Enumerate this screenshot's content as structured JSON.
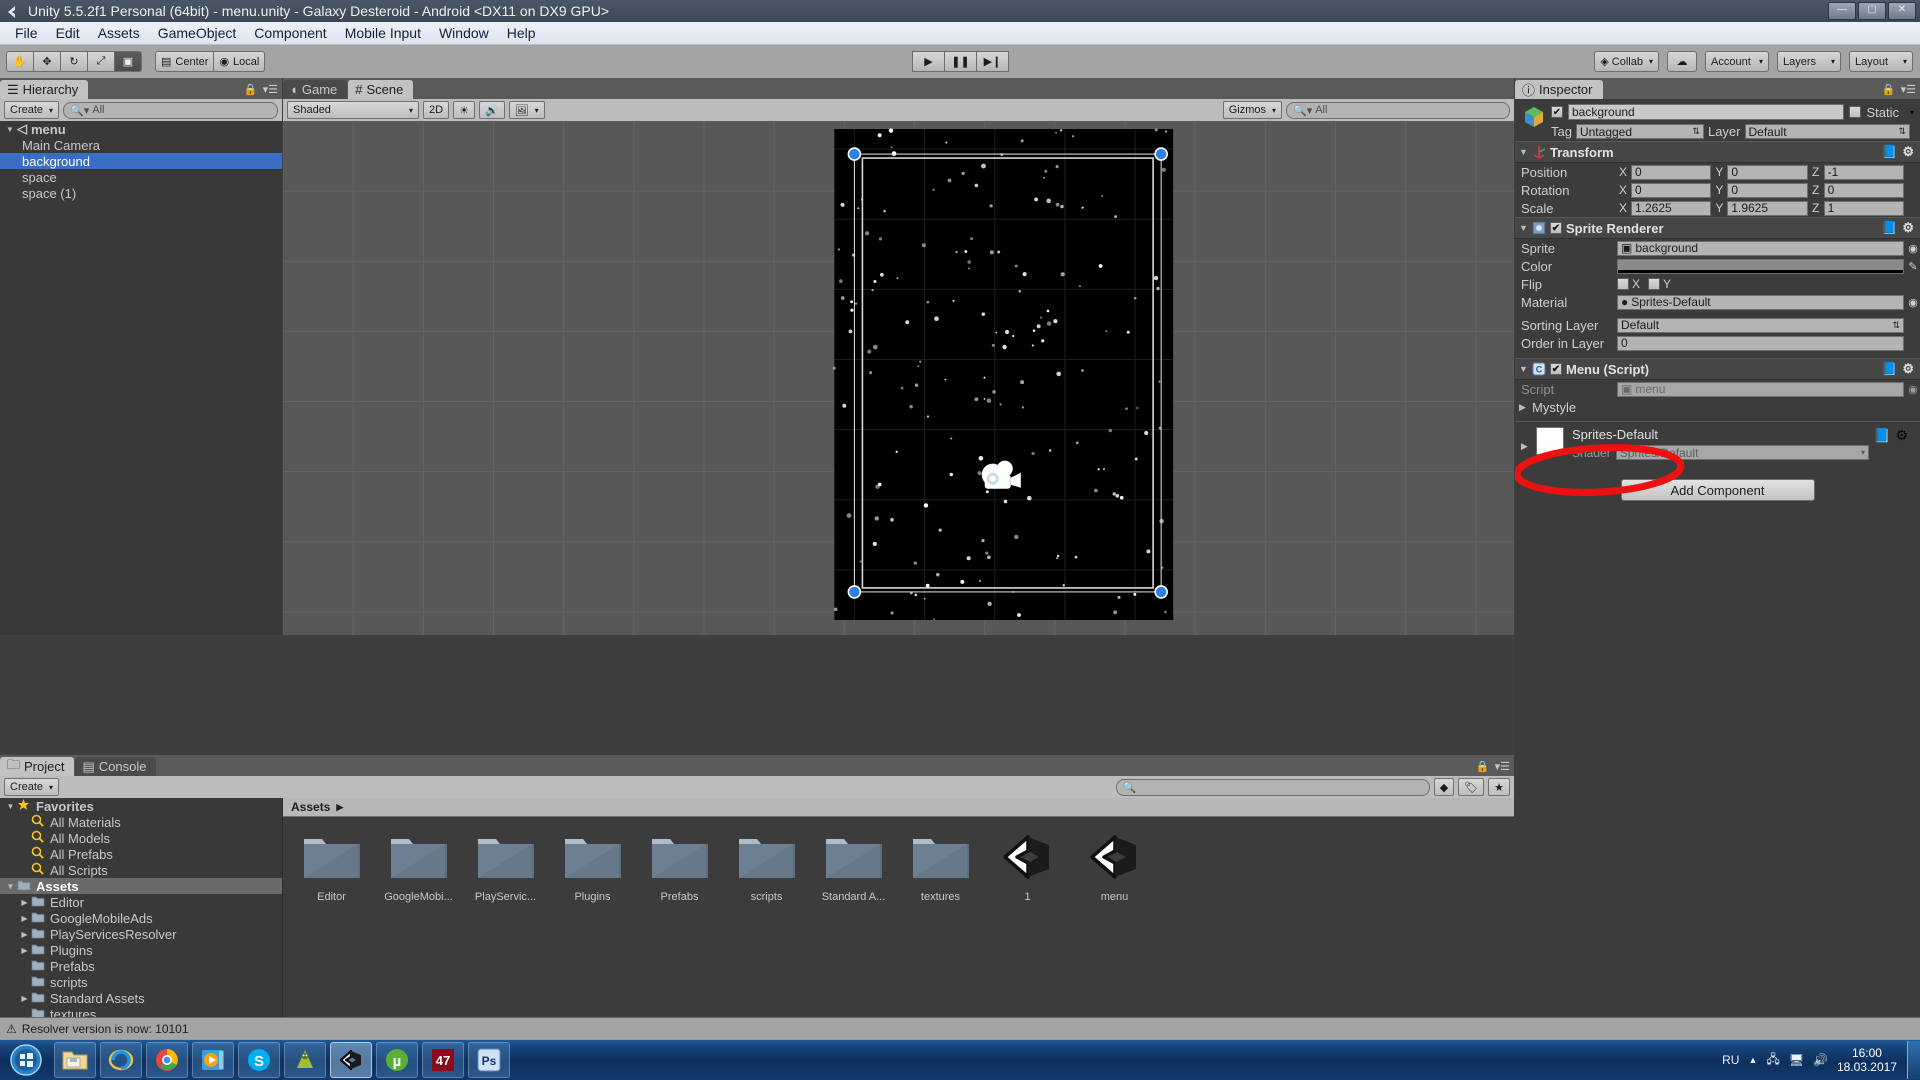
{
  "window": {
    "title": "Unity 5.5.2f1 Personal (64bit) - menu.unity - Galaxy Desteroid - Android <DX11 on DX9 GPU>",
    "minimize": "—",
    "maximize": "▢",
    "close": "✕"
  },
  "menubar": {
    "items": [
      "File",
      "Edit",
      "Assets",
      "GameObject",
      "Component",
      "Mobile Input",
      "Window",
      "Help"
    ]
  },
  "toolbar": {
    "tools": [
      {
        "name": "hand-tool",
        "glyph": "✋",
        "active": false
      },
      {
        "name": "move-tool",
        "glyph": "✥",
        "active": false
      },
      {
        "name": "rotate-tool",
        "glyph": "↻",
        "active": false
      },
      {
        "name": "scale-tool",
        "glyph": "⤢",
        "active": false
      },
      {
        "name": "rect-tool",
        "glyph": "▣",
        "active": true
      }
    ],
    "pivot_mode": "Center",
    "pivot_rotation": "Local",
    "play": "▶",
    "pause": "❚❚",
    "step": "▶❙",
    "collab": "Collab",
    "cloud": "☁",
    "account": "Account",
    "layers": "Layers",
    "layout": "Layout"
  },
  "hierarchy": {
    "tab": "Hierarchy",
    "create": "Create",
    "search_placeholder": "All",
    "items": [
      {
        "label": "menu",
        "depth": 0,
        "selected": false,
        "root": true
      },
      {
        "label": "Main Camera",
        "depth": 1,
        "selected": false
      },
      {
        "label": "background",
        "depth": 1,
        "selected": true
      },
      {
        "label": "space",
        "depth": 1,
        "selected": false
      },
      {
        "label": "space (1)",
        "depth": 1,
        "selected": false
      }
    ]
  },
  "scene": {
    "tabs": [
      {
        "label": "Game",
        "selected": false,
        "icon": "game-icon"
      },
      {
        "label": "Scene",
        "selected": true,
        "icon": "scene-grid-icon"
      }
    ],
    "shading": "Shaded",
    "mode_2d": "2D",
    "lighting_icon": "☀",
    "audio_icon": "🔊",
    "effects_icon": "🖼",
    "gizmos": "Gizmos",
    "search_placeholder": "All"
  },
  "project": {
    "tabs": [
      {
        "label": "Project",
        "selected": true,
        "icon": "folder-icon"
      },
      {
        "label": "Console",
        "selected": false,
        "icon": "console-icon"
      }
    ],
    "create": "Create",
    "search_placeholder": "",
    "tree": [
      {
        "label": "Favorites",
        "depth": 0,
        "icon": "star",
        "arrow": "down",
        "bold": true
      },
      {
        "label": "All Materials",
        "depth": 1,
        "icon": "search",
        "arrow": ""
      },
      {
        "label": "All Models",
        "depth": 1,
        "icon": "search",
        "arrow": ""
      },
      {
        "label": "All Prefabs",
        "depth": 1,
        "icon": "search",
        "arrow": ""
      },
      {
        "label": "All Scripts",
        "depth": 1,
        "icon": "search",
        "arrow": ""
      },
      {
        "label": "Assets",
        "depth": 0,
        "icon": "folder",
        "arrow": "down",
        "bold": true,
        "selected": true
      },
      {
        "label": "Editor",
        "depth": 1,
        "icon": "folder",
        "arrow": "right"
      },
      {
        "label": "GoogleMobileAds",
        "depth": 1,
        "icon": "folder",
        "arrow": "right"
      },
      {
        "label": "PlayServicesResolver",
        "depth": 1,
        "icon": "folder",
        "arrow": "right"
      },
      {
        "label": "Plugins",
        "depth": 1,
        "icon": "folder",
        "arrow": "right"
      },
      {
        "label": "Prefabs",
        "depth": 1,
        "icon": "folder",
        "arrow": ""
      },
      {
        "label": "scripts",
        "depth": 1,
        "icon": "folder",
        "arrow": ""
      },
      {
        "label": "Standard Assets",
        "depth": 1,
        "icon": "folder",
        "arrow": "right"
      },
      {
        "label": "textures",
        "depth": 1,
        "icon": "folder",
        "arrow": ""
      }
    ],
    "breadcrumb": "Assets",
    "assets": [
      {
        "label": "Editor",
        "type": "folder"
      },
      {
        "label": "GoogleMobi...",
        "type": "folder"
      },
      {
        "label": "PlayServic...",
        "type": "folder"
      },
      {
        "label": "Plugins",
        "type": "folder"
      },
      {
        "label": "Prefabs",
        "type": "folder"
      },
      {
        "label": "scripts",
        "type": "folder"
      },
      {
        "label": "Standard A...",
        "type": "folder"
      },
      {
        "label": "textures",
        "type": "folder"
      },
      {
        "label": "1",
        "type": "scene"
      },
      {
        "label": "menu",
        "type": "scene"
      }
    ]
  },
  "inspector": {
    "tab": "Inspector",
    "object_name": "background",
    "object_enabled": true,
    "static_label": "Static",
    "tag_label": "Tag",
    "tag_value": "Untagged",
    "layer_label": "Layer",
    "layer_value": "Default",
    "transform": {
      "title": "Transform",
      "rows": [
        {
          "label": "Position",
          "x": "0",
          "y": "0",
          "z": "-1"
        },
        {
          "label": "Rotation",
          "x": "0",
          "y": "0",
          "z": "0"
        },
        {
          "label": "Scale",
          "x": "1.2625",
          "y": "1.9625",
          "z": "1"
        }
      ]
    },
    "sprite_renderer": {
      "title": "Sprite Renderer",
      "enabled": true,
      "sprite_label": "Sprite",
      "sprite_value": "background",
      "color_label": "Color",
      "color_value": "#8a8a8a",
      "flip_label": "Flip",
      "flip_x": "X",
      "flip_y": "Y",
      "material_label": "Material",
      "material_value": "Sprites-Default",
      "sorting_layer_label": "Sorting Layer",
      "sorting_layer_value": "Default",
      "order_in_layer_label": "Order in Layer",
      "order_in_layer_value": "0"
    },
    "menu_script": {
      "title": "Menu (Script)",
      "enabled": true,
      "script_label": "Script",
      "script_value": "menu",
      "mystyle_label": "Mystyle"
    },
    "material_preview": {
      "name": "Sprites-Default",
      "shader_label": "Shader",
      "shader_value": "Sprites/Default"
    },
    "add_component": "Add Component"
  },
  "annotation": {
    "shape": "red-ellipse",
    "color": "#ee1111",
    "target": "Menu (Script)"
  },
  "statusbar": {
    "message": "Resolver version is now: 10101",
    "icon": "warning-icon"
  },
  "taskbar": {
    "start": "start-orb",
    "items": [
      {
        "name": "explorer",
        "label": "Explorer",
        "pinned": true
      },
      {
        "name": "internet-explorer",
        "label": "Internet Explorer",
        "pinned": true
      },
      {
        "name": "chrome",
        "label": "Google Chrome",
        "pinned": true
      },
      {
        "name": "media-player",
        "label": "Media Player",
        "pinned": true
      },
      {
        "name": "skype",
        "label": "Skype",
        "pinned": true
      },
      {
        "name": "android-studio",
        "label": "Android Studio",
        "pinned": true
      },
      {
        "name": "unity",
        "label": "Unity",
        "pinned": true,
        "active": true
      },
      {
        "name": "utorrent",
        "label": "uTorrent",
        "pinned": true
      },
      {
        "name": "app-47",
        "label": "47",
        "pinned": true
      },
      {
        "name": "photoshop",
        "label": "Photoshop",
        "pinned": true
      }
    ],
    "tray": {
      "language": "RU",
      "time": "16:00",
      "date": "18.03.2017"
    }
  }
}
